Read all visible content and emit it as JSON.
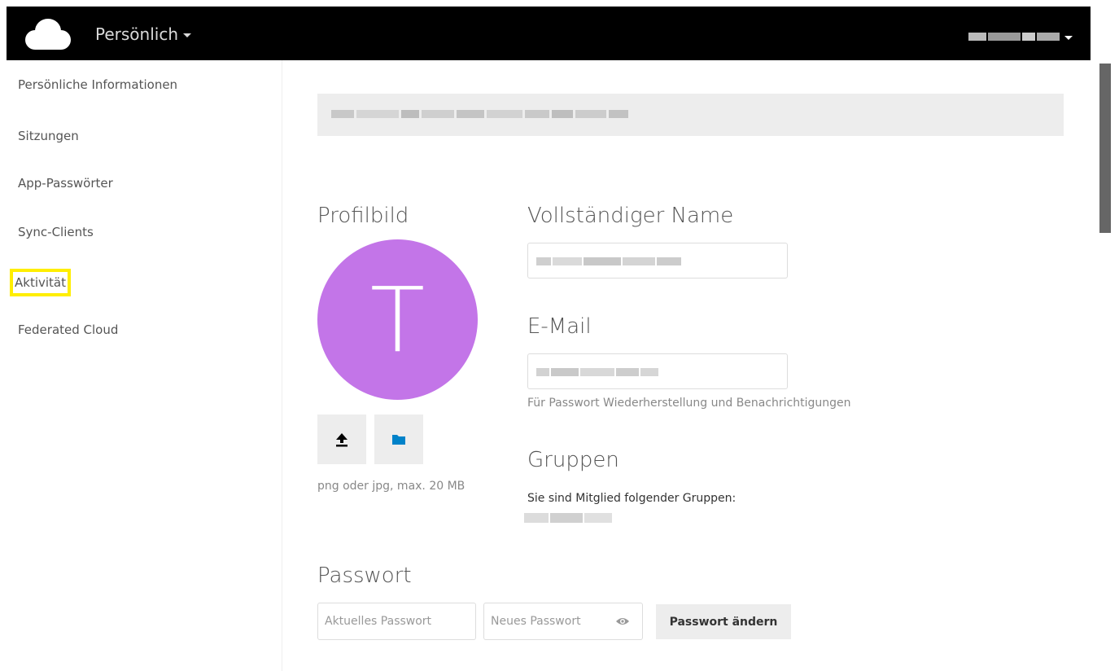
{
  "header": {
    "app_label": "Persönlich"
  },
  "sidebar": {
    "items": [
      {
        "label": "Persönliche Informationen"
      },
      {
        "label": "Sitzungen"
      },
      {
        "label": "App-Passwörter"
      },
      {
        "label": "Sync-Clients"
      },
      {
        "label": "Aktivität"
      },
      {
        "label": "Federated Cloud"
      }
    ]
  },
  "profile": {
    "picture_title": "Profilbild",
    "avatar_letter": "T",
    "avatar_color": "#c375e8",
    "upload_icon": "upload-icon",
    "folder_icon": "folder-icon",
    "folder_icon_color": "#0082c9",
    "file_hint": "png oder jpg, max. 20 MB"
  },
  "fullname": {
    "title": "Vollständiger Name"
  },
  "email": {
    "title": "E-Mail",
    "hint": "Für Passwort Wiederherstellung und Benachrichtigungen"
  },
  "groups": {
    "title": "Gruppen",
    "label": "Sie sind Mitglied folgender Gruppen:"
  },
  "password": {
    "title": "Passwort",
    "current_placeholder": "Aktuelles Passwort",
    "new_placeholder": "Neues Passwort",
    "show_icon": "eye-icon",
    "change_button": "Passwort ändern"
  },
  "colors": {
    "header_bg": "#000000",
    "highlight": "#ffee00"
  }
}
